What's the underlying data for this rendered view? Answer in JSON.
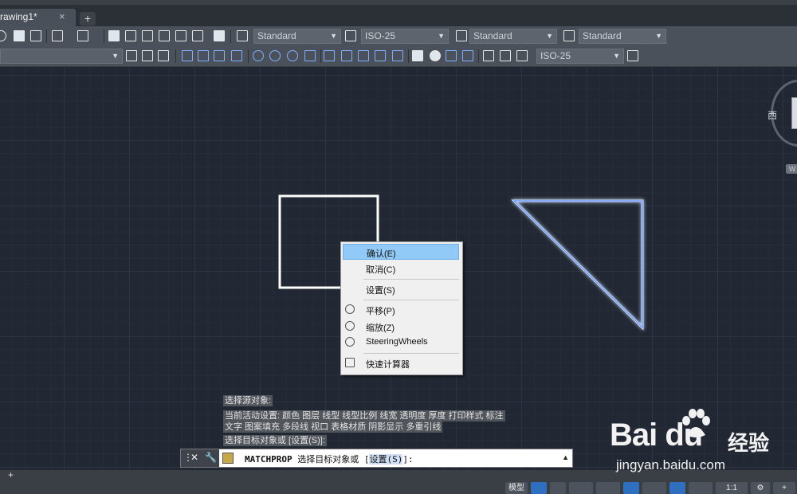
{
  "tabs": {
    "doc_tab_label": "rawing1*",
    "close_glyph": "×",
    "new_tab_glyph": "+"
  },
  "toolbar": {
    "text_style": "Standard",
    "dim_style": "ISO-25",
    "table_style": "Standard",
    "multileader_style": "Standard",
    "dim_style_2": "ISO-25"
  },
  "view": {
    "compass_west": "西",
    "wcs_badge": "W"
  },
  "context_menu": {
    "items": [
      {
        "label": "确认(E)",
        "icon": "",
        "highlighted": true
      },
      {
        "label": "取消(C)",
        "icon": ""
      },
      {
        "label": "设置(S)",
        "icon": ""
      },
      {
        "label": "平移(P)",
        "icon": "pan-icon"
      },
      {
        "label": "缩放(Z)",
        "icon": "zoom-icon"
      },
      {
        "label": "SteeringWheels",
        "icon": "steering-wheels-icon"
      },
      {
        "label": "快速计算器",
        "icon": "calculator-icon"
      }
    ]
  },
  "command_history": {
    "line1": "选择源对象:",
    "line2a": "当前活动设置: 颜色 图层 线型 线型比例 线宽 透明度 厚度 打印样式 标注",
    "line2b": "文字 图案填充 多段线 视口 表格材质 阴影显示 多重引线",
    "line3": "选择目标对象或 [设置(S)]:"
  },
  "command_line": {
    "command": "MATCHPROP",
    "prompt": "选择目标对象或 [",
    "option": "设置(S)",
    "suffix": "]:"
  },
  "statusbar": {
    "model_label": "模型",
    "scale": "1:1"
  },
  "watermark": {
    "brand": "Bai du",
    "cn": "经验",
    "url": "jingyan.baidu.com"
  }
}
